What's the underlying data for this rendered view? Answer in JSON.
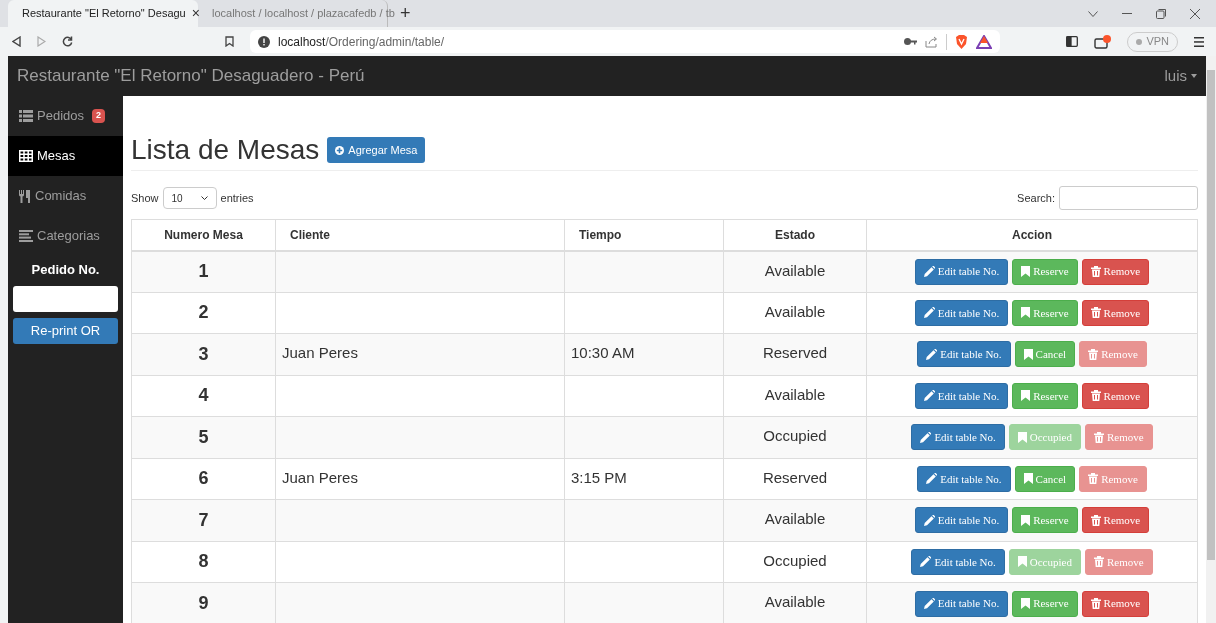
{
  "browser": {
    "tabs": [
      {
        "title": "Restaurante \"El Retorno\" Desagu",
        "selected": true,
        "close": "×"
      },
      {
        "title": "localhost / localhost / plazacafedb / tb",
        "selected": false
      }
    ],
    "new_tab": "+",
    "address_host": "localhost",
    "address_path": "/Ordering/admin/table/",
    "vpn": "VPN"
  },
  "navbar": {
    "brand": "Restaurante \"El Retorno\" Desaguadero - Perú",
    "user": "luis"
  },
  "sidebar": {
    "items": [
      {
        "kind": "list",
        "label": "Pedidos",
        "badge": "2",
        "selected": false
      },
      {
        "kind": "table",
        "label": "Mesas",
        "selected": true
      },
      {
        "kind": "food",
        "label": "Comidas",
        "selected": false
      },
      {
        "kind": "lines",
        "label": "Categorias",
        "selected": false
      }
    ],
    "order_label": "Pedido No.",
    "reprint": "Re-print OR"
  },
  "page": {
    "title": "Lista de Mesas",
    "add_button": "Agregar Mesa",
    "show": "Show",
    "entries_value": "10",
    "entries": "entries",
    "search": "Search:"
  },
  "table": {
    "columns": [
      "Numero Mesa",
      "Cliente",
      "Tiempo",
      "Estado",
      "Accion"
    ],
    "rows": [
      {
        "number": "1",
        "estado": "Available",
        "actions": [
          {
            "kind": "edit",
            "label": "Edit table No."
          },
          {
            "kind": "status",
            "label": "Reserve",
            "disabled": false
          },
          {
            "kind": "remove",
            "label": "Remove",
            "disabled": false
          }
        ]
      },
      {
        "number": "2",
        "estado": "Available",
        "actions": [
          {
            "kind": "edit",
            "label": "Edit table No."
          },
          {
            "kind": "status",
            "label": "Reserve",
            "disabled": false
          },
          {
            "kind": "remove",
            "label": "Remove",
            "disabled": false
          }
        ]
      },
      {
        "number": "3",
        "cliente": "Juan Peres",
        "tiempo": "10:30 AM",
        "estado": "Reserved",
        "actions": [
          {
            "kind": "edit",
            "label": "Edit table No."
          },
          {
            "kind": "status",
            "label": "Cancel",
            "disabled": false
          },
          {
            "kind": "remove",
            "label": "Remove",
            "disabled": true
          }
        ]
      },
      {
        "number": "4",
        "estado": "Available",
        "actions": [
          {
            "kind": "edit",
            "label": "Edit table No."
          },
          {
            "kind": "status",
            "label": "Reserve",
            "disabled": false
          },
          {
            "kind": "remove",
            "label": "Remove",
            "disabled": false
          }
        ]
      },
      {
        "number": "5",
        "estado": "Occupied",
        "actions": [
          {
            "kind": "edit",
            "label": "Edit table No."
          },
          {
            "kind": "status",
            "label": "Occupied",
            "disabled": true
          },
          {
            "kind": "remove",
            "label": "Remove",
            "disabled": true
          }
        ]
      },
      {
        "number": "6",
        "cliente": "Juan Peres",
        "tiempo": "3:15 PM",
        "estado": "Reserved",
        "actions": [
          {
            "kind": "edit",
            "label": "Edit table No."
          },
          {
            "kind": "status",
            "label": "Cancel",
            "disabled": false
          },
          {
            "kind": "remove",
            "label": "Remove",
            "disabled": true
          }
        ]
      },
      {
        "number": "7",
        "estado": "Available",
        "actions": [
          {
            "kind": "edit",
            "label": "Edit table No."
          },
          {
            "kind": "status",
            "label": "Reserve",
            "disabled": false
          },
          {
            "kind": "remove",
            "label": "Remove",
            "disabled": false
          }
        ]
      },
      {
        "number": "8",
        "estado": "Occupied",
        "actions": [
          {
            "kind": "edit",
            "label": "Edit table No."
          },
          {
            "kind": "status",
            "label": "Occupied",
            "disabled": true
          },
          {
            "kind": "remove",
            "label": "Remove",
            "disabled": true
          }
        ]
      },
      {
        "number": "9",
        "estado": "Available",
        "actions": [
          {
            "kind": "edit",
            "label": "Edit table No."
          },
          {
            "kind": "status",
            "label": "Reserve",
            "disabled": false
          },
          {
            "kind": "remove",
            "label": "Remove",
            "disabled": false
          }
        ]
      }
    ]
  }
}
